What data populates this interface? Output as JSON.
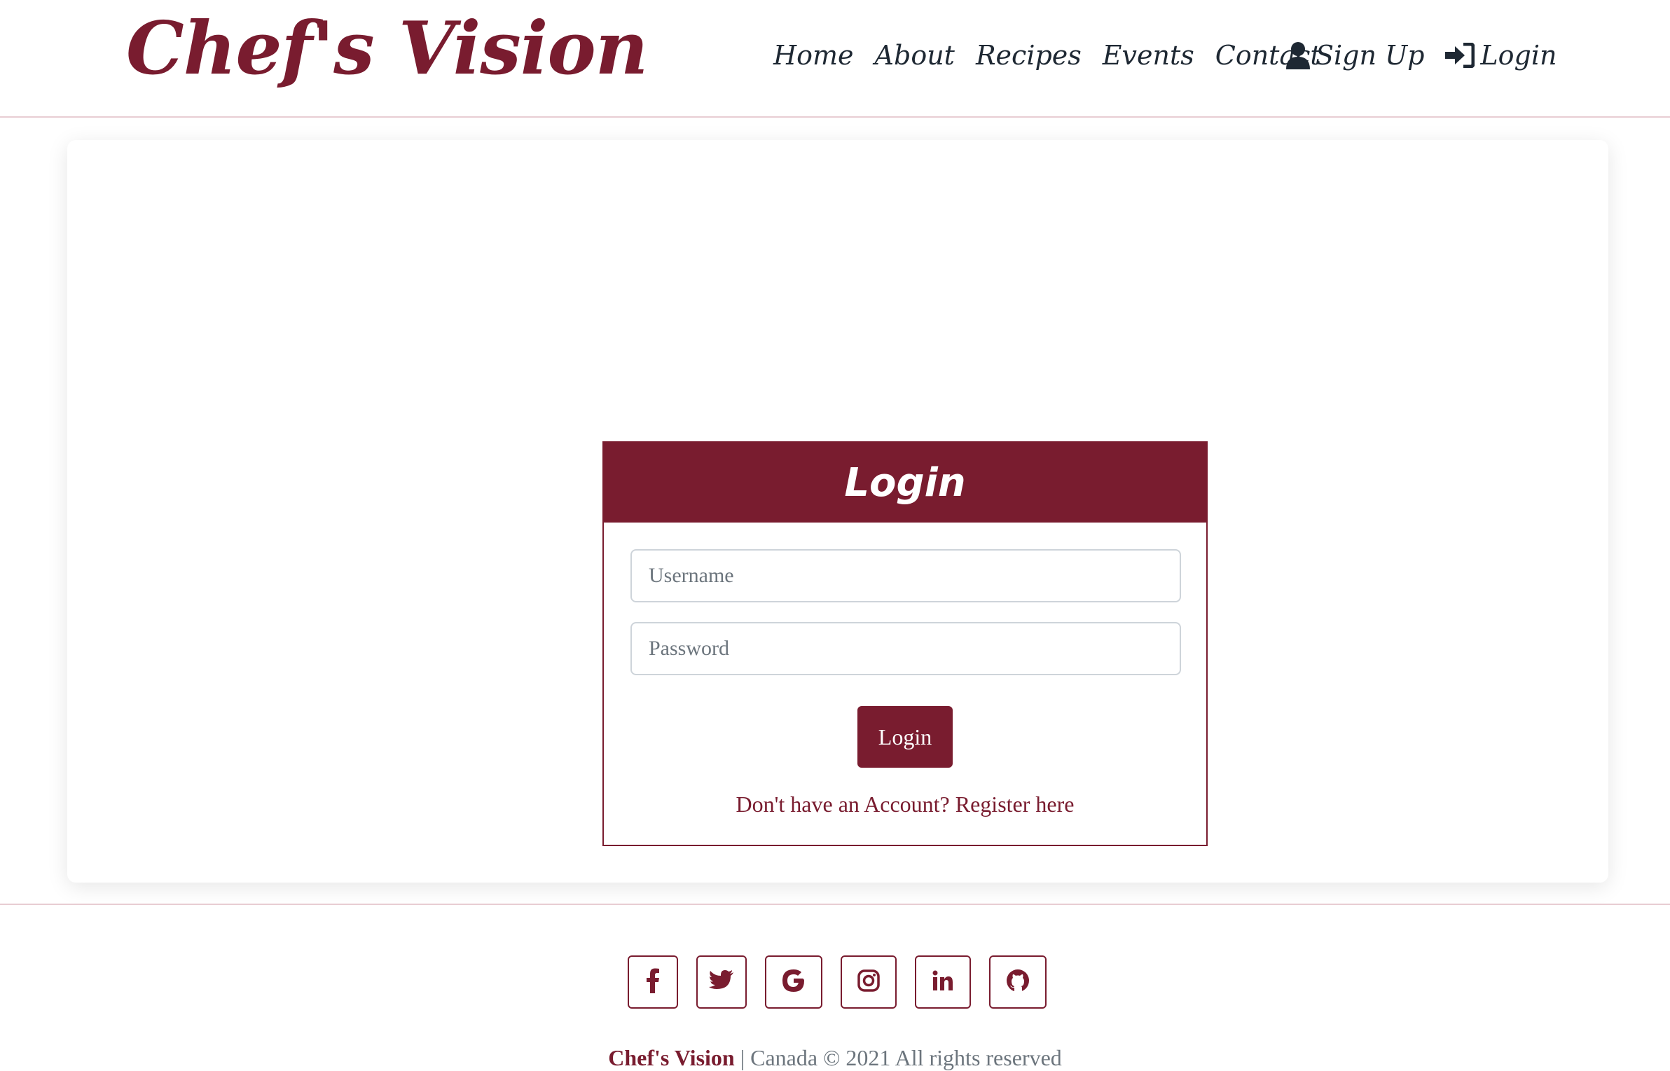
{
  "brand": {
    "name": "Chef's Vision",
    "color": "#791c2f"
  },
  "nav": {
    "links": [
      "Home",
      "About",
      "Recipes",
      "Events",
      "Contact"
    ],
    "signup": {
      "label": "Sign Up",
      "icon": "user-icon"
    },
    "login": {
      "label": "Login",
      "icon": "sign-in-icon"
    }
  },
  "login_form": {
    "title": "Login",
    "username_placeholder": "Username",
    "password_placeholder": "Password",
    "submit_label": "Login",
    "register_text": "Don't have an Account? Register here"
  },
  "footer": {
    "social_icons": [
      "facebook-icon",
      "twitter-icon",
      "google-icon",
      "instagram-icon",
      "linkedin-icon",
      "github-icon"
    ],
    "brand": "Chef's Vision",
    "copyright_rest": " | Canada © 2021 All rights reserved"
  },
  "colors": {
    "accent": "#791c2f",
    "nav_text": "#1e2833",
    "divider": "#e8cdd3"
  }
}
